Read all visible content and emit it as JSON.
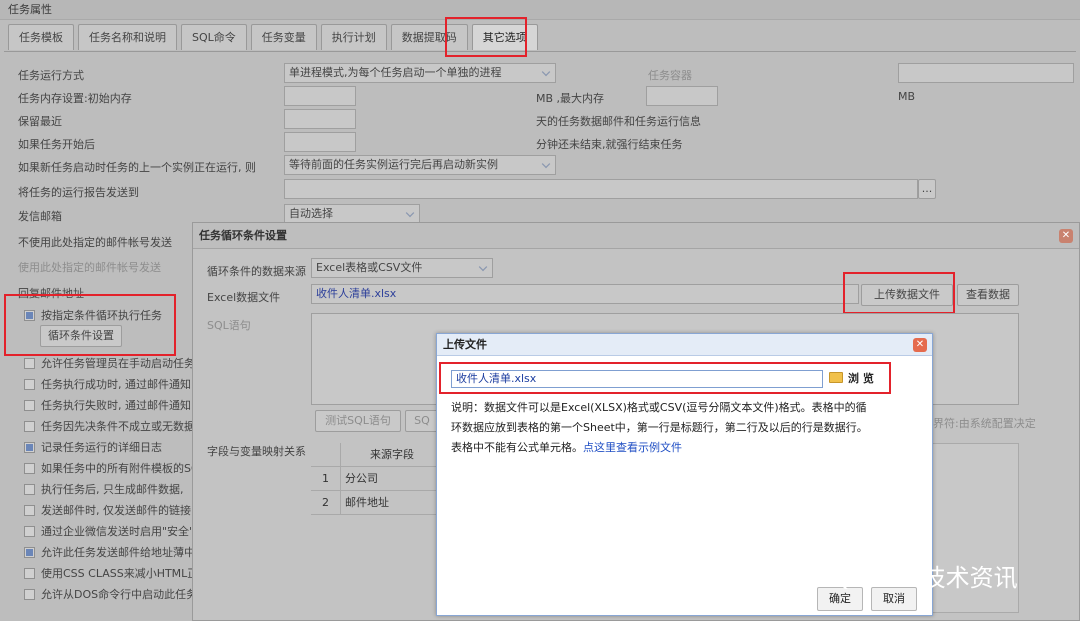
{
  "window_title": "任务属性",
  "tabs": [
    "任务模板",
    "任务名称和说明",
    "SQL命令",
    "任务变量",
    "执行计划",
    "数据提取码",
    "其它选项"
  ],
  "active_tab": "其它选项",
  "form": {
    "run_mode_label": "任务运行方式",
    "run_mode_value": "单进程模式,为每个任务启动一个单独的进程",
    "container_label": "任务容器",
    "memory_label": "任务内存设置:初始内存",
    "memory_mid": "MB ,最大内存",
    "memory_unit": "MB",
    "keep_recent_label": "保留最近",
    "keep_recent_suffix": "天的任务数据邮件和任务运行信息",
    "after_start_label": "如果任务开始后",
    "after_start_suffix": "分钟还未结束,就强行结束任务",
    "if_running_label": "如果新任务启动时任务的上一个实例正在运行, 则",
    "if_running_value": "等待前面的任务实例运行完后再启动新实例",
    "send_report_label": "将任务的运行报告发送到",
    "browse_dots": "...",
    "mailbox_label": "发信邮箱",
    "mailbox_value": "自动选择",
    "not_use_account_label": "不使用此处指定的邮件帐号发送",
    "use_account_label": "使用此处指定的邮件帐号发送",
    "reply_label": "回复邮件地址"
  },
  "checkboxes": [
    {
      "label": "按指定条件循环执行任务",
      "checked": true
    },
    {
      "label": "允许任务管理员在手动启动任务",
      "checked": false
    },
    {
      "label": "任务执行成功时, 通过邮件通知",
      "checked": false
    },
    {
      "label": "任务执行失败时, 通过邮件通知",
      "checked": false
    },
    {
      "label": "任务因先决条件不成立或无数据",
      "checked": false
    },
    {
      "label": "记录任务运行的详细日志",
      "checked": true
    },
    {
      "label": "如果任务中的所有附件模板的SQ",
      "checked": false
    },
    {
      "label": "执行任务后, 只生成邮件数据,",
      "checked": false
    },
    {
      "label": "发送邮件时, 仅发送邮件的链接",
      "checked": false
    },
    {
      "label": "通过企业微信发送时启用\"安全\"",
      "checked": false
    },
    {
      "label": "允许此任务发送邮件给地址薄中",
      "checked": true
    },
    {
      "label": "使用CSS CLASS来减小HTML正文",
      "checked": false
    },
    {
      "label": "允许从DOS命令行中启动此任务",
      "checked": false
    }
  ],
  "loop_setting_button": "循环条件设置",
  "loop_dialog": {
    "title": "任务循环条件设置",
    "close": "✕",
    "source_label": "循环条件的数据来源",
    "source_value": "Excel表格或CSV文件",
    "excel_label": "Excel数据文件",
    "excel_value": "收件人清单.xlsx",
    "upload_button": "上传数据文件",
    "view_button": "查看数据",
    "sql_label": "SQL语句",
    "test_sql_button": "测试SQL语句",
    "sql2_button": "SQ",
    "delimiter_text": "界符:由系统配置决定",
    "mapping_label": "字段与变量映射关系",
    "grid_header": "来源字段",
    "grid_rows": [
      {
        "num": "1",
        "field": "分公司"
      },
      {
        "num": "2",
        "field": "邮件地址"
      }
    ]
  },
  "upload_dialog": {
    "title": "上传文件",
    "close": "✕",
    "file_value": "收件人清单.xlsx",
    "browse_label": "浏 览",
    "desc_text": "说明：数据文件可以是Excel(XLSX)格式或CSV(逗号分隔文本文件)格式。表格中的循环数据应放到表格的第一个Sheet中，第一行是标题行，第二行及以后的行是数据行。表格中不能有公式单元格。",
    "desc_link": "点这里查看示例文件",
    "ok": "确定",
    "cancel": "取消"
  },
  "watermark": "EasySQLMAIL技术资讯"
}
